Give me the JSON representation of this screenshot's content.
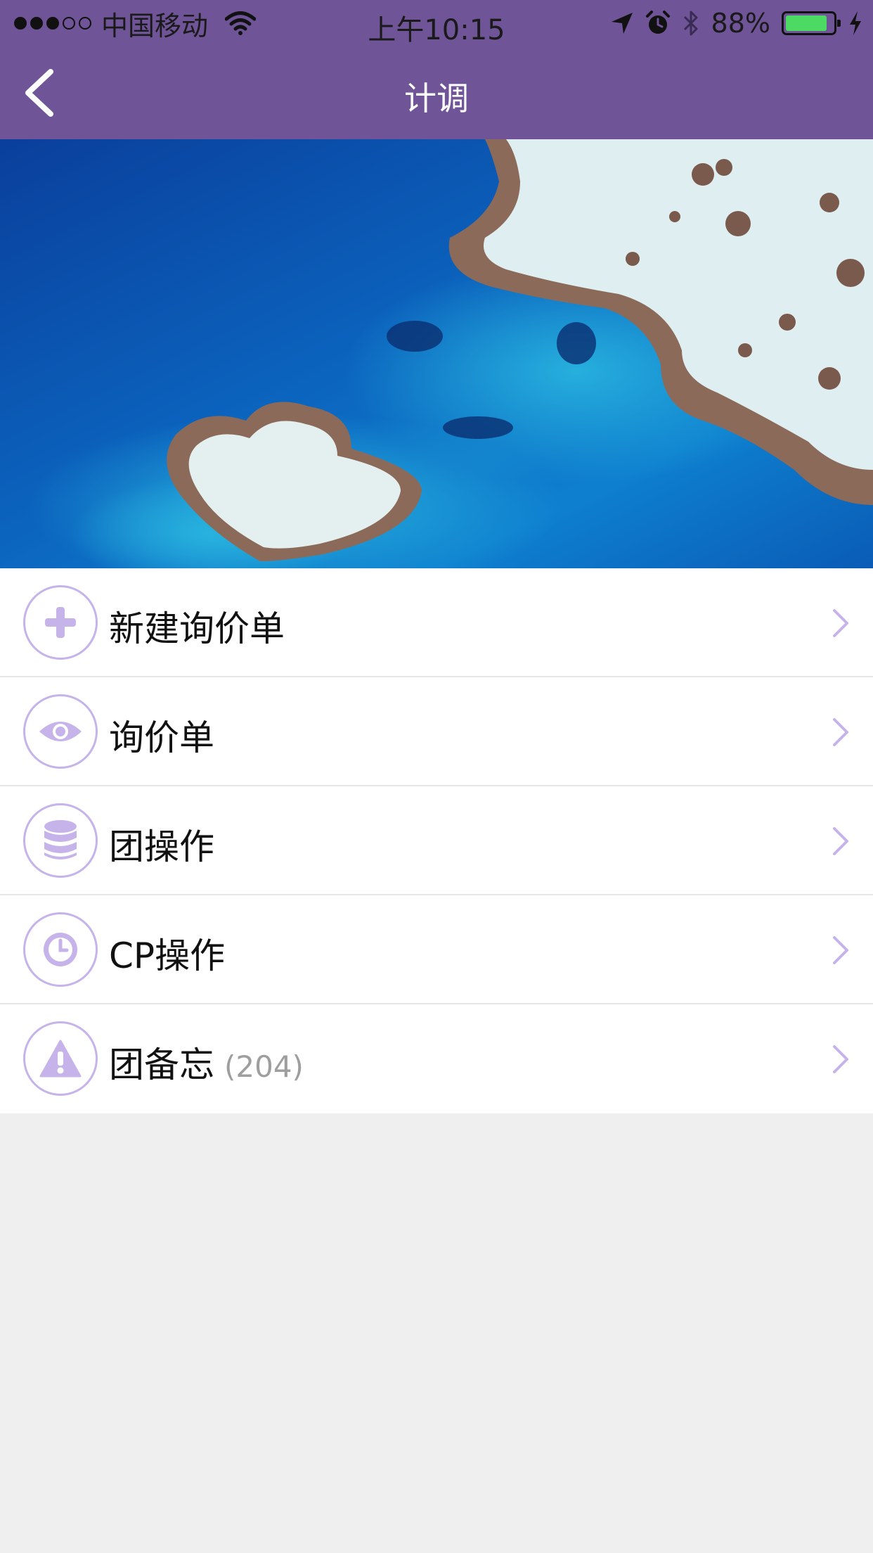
{
  "status_bar": {
    "carrier": "中国移动",
    "time": "上午10:15",
    "battery_percent_text": "88%",
    "battery_level": 0.88,
    "signal_bars_filled": 3,
    "signal_bars_total": 5
  },
  "nav": {
    "title": "计调",
    "back_icon": "chevron-left-icon"
  },
  "hero": {
    "description_icon": "heart-reef-photo"
  },
  "menu": {
    "items": [
      {
        "label": "新建询价单",
        "icon": "plus-icon",
        "count": ""
      },
      {
        "label": "询价单",
        "icon": "eye-icon",
        "count": ""
      },
      {
        "label": "团操作",
        "icon": "database-icon",
        "count": ""
      },
      {
        "label": "CP操作",
        "icon": "clock-icon",
        "count": ""
      },
      {
        "label": "团备忘",
        "icon": "warning-icon",
        "count": "(204)"
      }
    ]
  },
  "colors": {
    "accent": "#6f5498",
    "icon_tint": "#c5b3ea",
    "background": "#efefef",
    "count_text": "#9e9e9e"
  }
}
